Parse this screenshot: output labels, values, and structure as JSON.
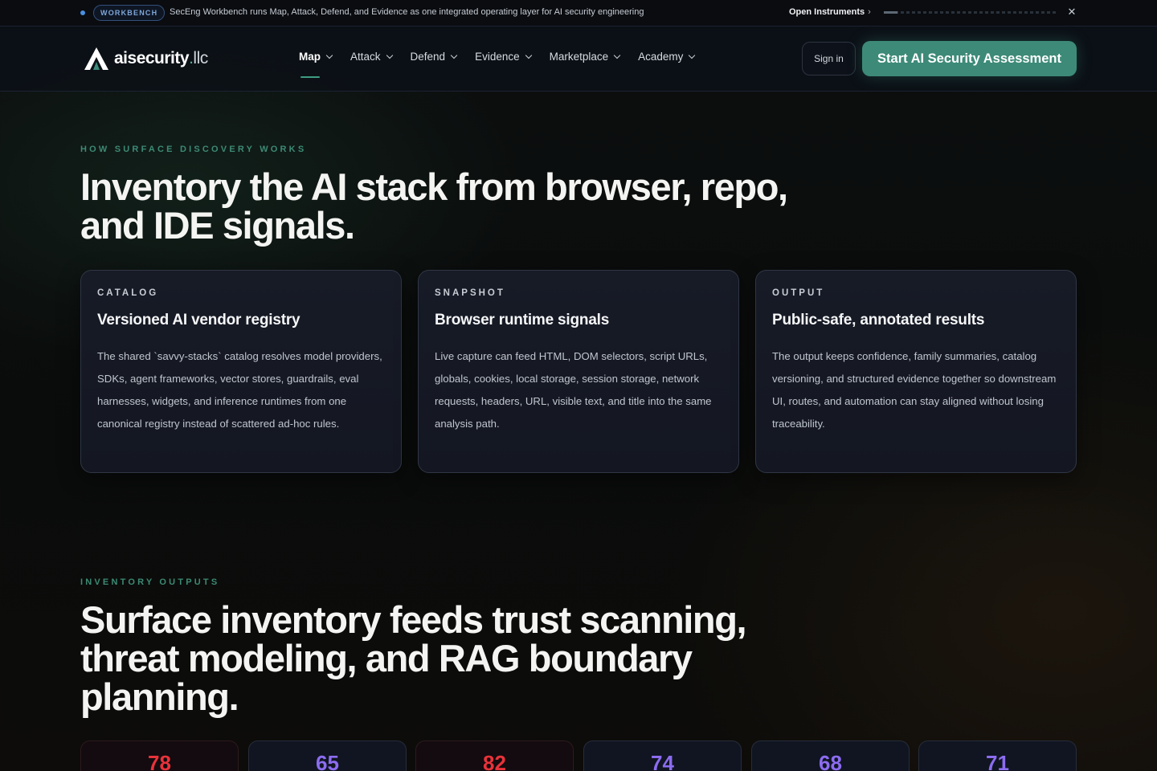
{
  "announcement": {
    "badge": "WORKBENCH",
    "message": "SecEng Workbench runs Map, Attack, Defend, and Evidence as one integrated operating layer for AI security engineering",
    "link_label": "Open Instruments",
    "link_chevron": "›",
    "close_glyph": "✕",
    "progress": 0.08
  },
  "header": {
    "logo_word": "aisecurity",
    "logo_dot": ".",
    "logo_tld": "llc",
    "nav": [
      {
        "label": "Map",
        "active": true
      },
      {
        "label": "Attack"
      },
      {
        "label": "Defend"
      },
      {
        "label": "Evidence"
      },
      {
        "label": "Marketplace"
      },
      {
        "label": "Academy"
      }
    ],
    "signin_label": "Sign in",
    "cta_label": "Start AI Security Assessment"
  },
  "section_discovery": {
    "eyebrow": "HOW SURFACE DISCOVERY WORKS",
    "heading_line1": "Inventory the AI stack from browser, repo,",
    "heading_line2": "and IDE signals.",
    "cards": [
      {
        "kicker": "CATALOG",
        "title": "Versioned AI vendor registry",
        "body": "The shared `savvy-stacks` catalog resolves model providers, SDKs, agent frameworks, vector stores, guardrails, eval harnesses, widgets, and inference runtimes from one canonical registry instead of scattered ad-hoc rules."
      },
      {
        "kicker": "SNAPSHOT",
        "title": "Browser runtime signals",
        "body": "Live capture can feed HTML, DOM selectors, script URLs, globals, cookies, local storage, session storage, network requests, headers, URL, visible text, and title into the same analysis path."
      },
      {
        "kicker": "OUTPUT",
        "title": "Public-safe, annotated results",
        "body": "The output keeps confidence, family summaries, catalog versioning, and structured evidence together so downstream UI, routes, and automation can stay aligned without losing traceability."
      }
    ]
  },
  "section_outputs": {
    "eyebrow": "INVENTORY OUTPUTS",
    "heading_line1": "Surface inventory feeds trust scanning,",
    "heading_line2": "threat modeling, and RAG boundary",
    "heading_line3": "planning.",
    "scores": [
      {
        "value": "78",
        "color": "#e8323a"
      },
      {
        "value": "65",
        "color": "#8c6cf0"
      },
      {
        "value": "82",
        "color": "#e8323a"
      },
      {
        "value": "74",
        "color": "#8c6cf0"
      },
      {
        "value": "68",
        "color": "#8c6cf0"
      },
      {
        "value": "71",
        "color": "#8c6cf0"
      }
    ]
  },
  "colors": {
    "accent": "#3d8a78",
    "eyebrow": "#3d8a74",
    "score_red": "#e8323a",
    "score_purple": "#8c6cf0"
  }
}
